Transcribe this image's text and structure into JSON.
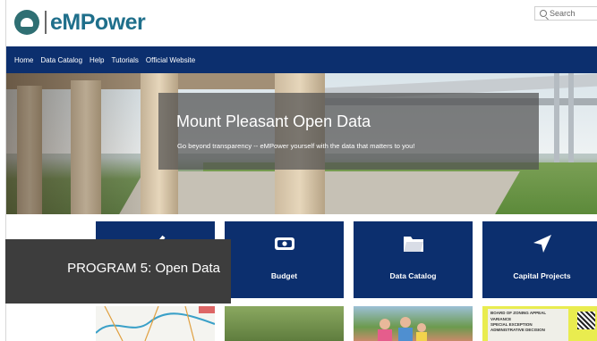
{
  "header": {
    "logo_text": "eMPower",
    "search_placeholder": "Search"
  },
  "nav": {
    "items": [
      "Home",
      "Data Catalog",
      "Help",
      "Tutorials",
      "Official Website"
    ]
  },
  "hero": {
    "title": "Mount Pleasant Open Data",
    "subtitle": "Go beyond transparency -- eMPower yourself with the data that matters to you!"
  },
  "tiles": [
    {
      "label": "",
      "icon": "check-icon"
    },
    {
      "label": "Budget",
      "icon": "budget-icon"
    },
    {
      "label": "Data Catalog",
      "icon": "folder-icon"
    },
    {
      "label": "Capital Projects",
      "icon": "navigation-arrow-icon"
    }
  ],
  "thumbnails": [
    {
      "type": "map"
    },
    {
      "type": "grass"
    },
    {
      "type": "people"
    },
    {
      "type": "sign",
      "lines": [
        "BOARD OF ZONING APPEAL",
        "VARIANCE",
        "SPECIAL EXCEPTION",
        "ADMINISTRATIVE DECISION"
      ]
    }
  ],
  "overlay": {
    "caption": "PROGRAM 5: Open Data"
  },
  "colors": {
    "nav": "#0c2f6e",
    "tile": "#0c2f6e",
    "logo": "#1f6f8b",
    "overlay": "#3d3d3d"
  }
}
